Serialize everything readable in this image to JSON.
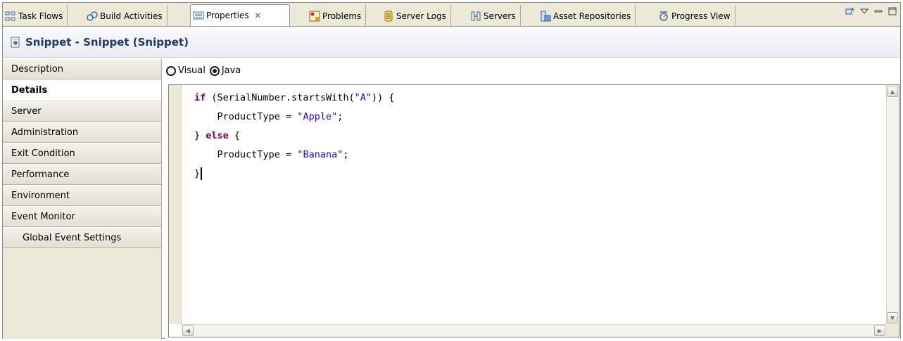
{
  "tabs": [
    {
      "label": "Task Flows",
      "icon": "task-flows-icon"
    },
    {
      "label": "Build Activities",
      "icon": "build-activities-icon"
    },
    {
      "label": "Properties",
      "icon": "properties-icon",
      "active": true
    },
    {
      "label": "Problems",
      "icon": "problems-icon"
    },
    {
      "label": "Server Logs",
      "icon": "server-logs-icon"
    },
    {
      "label": "Servers",
      "icon": "servers-icon"
    },
    {
      "label": "Asset Repositories",
      "icon": "asset-repositories-icon"
    },
    {
      "label": "Progress View",
      "icon": "progress-view-icon"
    }
  ],
  "title": "Snippet - Snippet (Snippet)",
  "sidebar": {
    "items": [
      {
        "label": "Description"
      },
      {
        "label": "Details",
        "selected": true
      },
      {
        "label": "Server"
      },
      {
        "label": "Administration"
      },
      {
        "label": "Exit Condition"
      },
      {
        "label": "Performance"
      },
      {
        "label": "Environment"
      },
      {
        "label": "Event Monitor"
      },
      {
        "label": "Global Event Settings",
        "sub": true
      }
    ]
  },
  "editor_mode": {
    "options": [
      {
        "label": "Visual",
        "selected": false
      },
      {
        "label": "Java",
        "selected": true
      }
    ]
  },
  "code_lines": [
    "if (SerialNumber.startsWith(\"A\")) {",
    "    ProductType = \"Apple\";",
    "} else {",
    "    ProductType = \"Banana\";",
    "}"
  ],
  "colors": {
    "keyword": "#7f0055",
    "string": "#2a00ff",
    "title": "#1f3a6b"
  }
}
